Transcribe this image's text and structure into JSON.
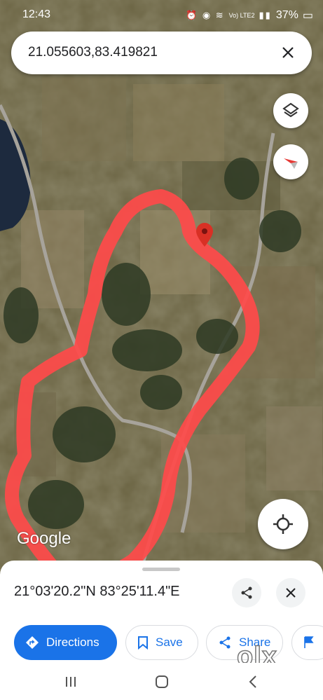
{
  "status_bar": {
    "time": "12:43",
    "battery": "37%",
    "net_label": "Vo) LTE2"
  },
  "search": {
    "query": "21.055603,83.419821"
  },
  "map": {
    "attribution": "Google",
    "accent_color": "#ff4a4a",
    "pin_color": "#d93025"
  },
  "place_sheet": {
    "coordinates": "21°03'20.2\"N 83°25'11.4\"E",
    "actions": {
      "directions": "Directions",
      "save": "Save",
      "share": "Share"
    }
  },
  "watermark": "olx",
  "icons": [
    "layers-icon",
    "compass-icon",
    "my-location-icon",
    "close-icon",
    "share-icon",
    "bookmark-icon",
    "directions-icon",
    "flag-icon"
  ]
}
